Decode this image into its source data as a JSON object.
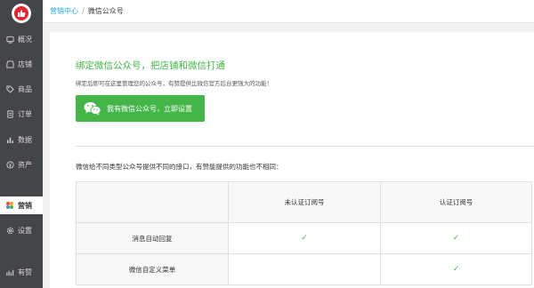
{
  "sidebar": {
    "logo": "thumbs-up-logo",
    "items": [
      {
        "label": "概况",
        "icon": "overview-icon"
      },
      {
        "label": "店铺",
        "icon": "store-icon"
      },
      {
        "label": "商品",
        "icon": "tag-icon"
      },
      {
        "label": "订单",
        "icon": "order-icon"
      },
      {
        "label": "数据",
        "icon": "bar-chart-icon"
      },
      {
        "label": "资产",
        "icon": "yen-icon"
      },
      {
        "label": "营销",
        "icon": "marketing-flower-icon",
        "active": true
      },
      {
        "label": "设置",
        "icon": "gear-icon"
      },
      {
        "label": "有赞",
        "icon": "youzan-icon"
      }
    ]
  },
  "breadcrumb": {
    "parent": "营销中心",
    "separator": "/",
    "current": "微信公众号"
  },
  "bind": {
    "title": "绑定微信公众号，把店铺和微信打通",
    "description": "绑定后即可在这里管理您的公众号，有赞提供比微信官方后台更强大的功能！",
    "button_label": "我有微信公众号，立即设置",
    "button_icon": "wechat-icon"
  },
  "compare": {
    "note": "微信给不同类型公众号提供不同的接口，有赞能提供的功能也不相同：",
    "headers": [
      "",
      "未认证订阅号",
      "认证订阅号"
    ],
    "rows": [
      {
        "feature": "消息自动回复",
        "unverified": "✓",
        "verified": "✓"
      },
      {
        "feature": "微信自定义菜单",
        "unverified": "",
        "verified": "✓"
      }
    ]
  },
  "colors": {
    "sidebar_bg": "#444548",
    "accent_green": "#44b549",
    "link_blue": "#27a9e1",
    "logo_red": "#e3262f"
  }
}
